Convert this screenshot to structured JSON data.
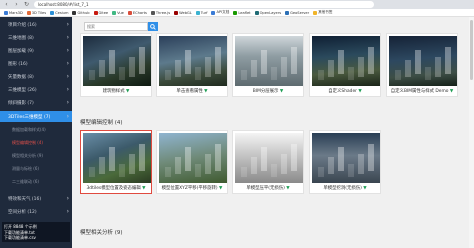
{
  "browser": {
    "url": "localhost:8080/#/list_7_1",
    "bookmarks": [
      {
        "label": "Mars3D",
        "color": "#3a7bd5"
      },
      {
        "label": "3D Tiles",
        "color": "#e36c3a"
      },
      {
        "label": "Cesium",
        "color": "#2b8fd6"
      },
      {
        "label": "Github",
        "color": "#333333"
      },
      {
        "label": "Gitee",
        "color": "#c7190f"
      },
      {
        "label": "Vue",
        "color": "#41b883"
      },
      {
        "label": "ECharts",
        "color": "#d94d3a"
      },
      {
        "label": "Three.js",
        "color": "#555555"
      },
      {
        "label": "WebGL",
        "color": "#990000"
      },
      {
        "label": "Turf",
        "color": "#3bb2d0"
      },
      {
        "label": "API文档",
        "color": "#3a7bd5"
      },
      {
        "label": "Leaflet",
        "color": "#199900"
      },
      {
        "label": "OpenLayers",
        "color": "#1f6b75"
      },
      {
        "label": "GeoServer",
        "color": "#2b6fb5"
      },
      {
        "label": "其他书签",
        "color": "#f0b429"
      }
    ]
  },
  "sidebar": {
    "items": [
      {
        "label": "项目介绍 (16)",
        "state": "normal"
      },
      {
        "label": "三维地图 (8)",
        "state": "normal"
      },
      {
        "label": "图层加载 (9)",
        "state": "normal"
      },
      {
        "label": "图形 (16)",
        "state": "normal"
      },
      {
        "label": "矢量数据 (8)",
        "state": "normal"
      },
      {
        "label": "三维模型 (26)",
        "state": "normal"
      },
      {
        "label": "倾斜摄影 (7)",
        "state": "normal"
      },
      {
        "label": "3DTiles三维模型 (7)",
        "state": "active"
      },
      {
        "label": "数据加载和样式(4)",
        "state": "sub"
      },
      {
        "label": "模型编辑控制 (4)",
        "state": "sub-alert"
      },
      {
        "label": "模型相关分析 (9)",
        "state": "sub"
      },
      {
        "label": "测量与标绘 (6)",
        "state": "sub"
      },
      {
        "label": "二三维联动 (6)",
        "state": "sub"
      },
      {
        "label": "特效和天气 (16)",
        "state": "normal"
      },
      {
        "label": "空间分析 (12)",
        "state": "normal"
      },
      {
        "label": "可视化 (4)",
        "state": "normal"
      }
    ],
    "footer": {
      "line1": "打开 8848 个示例",
      "line2": "下载功能清单.txt",
      "line3": "下载功能清单.csv"
    }
  },
  "search": {
    "placeholder": "搜索"
  },
  "sections": [
    {
      "title": "模型编辑控制 (4)"
    },
    {
      "title": "模型相关分析 (9)"
    }
  ],
  "cards_row1": [
    {
      "label": "建筑物样式"
    },
    {
      "label": "单击查看属性"
    },
    {
      "label": "BIM分层展示"
    },
    {
      "label": "自定义Shader"
    },
    {
      "label": "自定义BIM属性与样式 Demo"
    }
  ],
  "cards_row2": [
    {
      "label": "3dtiles模型位置及姿态编辑",
      "selected": true
    },
    {
      "label": "模型位置XYZ平移(平移旋转)"
    },
    {
      "label": "单模型压平(无损伤)"
    },
    {
      "label": "单模型挖洞(无损伤)"
    }
  ],
  "colors": {
    "accent": "#2f8fe8",
    "sidebar_bg": "#1f2a3c",
    "selected_border": "#e04a3f",
    "green_marker": "#1f9d55"
  }
}
